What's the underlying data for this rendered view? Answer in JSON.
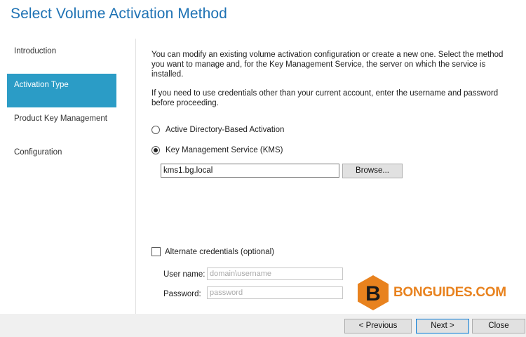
{
  "header": {
    "title": "Select Volume Activation Method"
  },
  "nav": {
    "items": [
      {
        "label": "Introduction"
      },
      {
        "label": "Activation Type"
      },
      {
        "label": "Product Key Management"
      },
      {
        "label": "Configuration"
      }
    ],
    "active_index": 1
  },
  "main": {
    "intro": "You can modify an existing volume activation configuration or create a new one. Select the method you want to manage and, for the Key Management Service, the server on which the service is installed.",
    "credentials_note": "If you need to use credentials other than your current account, enter the username and password before proceeding.",
    "options": [
      {
        "label": "Active Directory-Based Activation",
        "selected": false
      },
      {
        "label": "Key Management Service (KMS)",
        "selected": true
      }
    ],
    "server_value": "kms1.bg.local",
    "browse_label": "Browse...",
    "alt_credentials": {
      "label": "Alternate credentials (optional)",
      "checked": false
    },
    "username": {
      "label": "User name:",
      "placeholder": "domain\\username"
    },
    "password": {
      "label": "Password:",
      "placeholder": "password"
    }
  },
  "footer": {
    "previous_label": "< Previous",
    "next_label": "Next >",
    "close_label": "Close"
  },
  "watermark": {
    "letter": "B",
    "text": "BONGUIDES.COM",
    "color": "#e8821e"
  },
  "colors": {
    "title": "#1e72b4",
    "nav_active": "#2b9cc6",
    "default_button_border": "#0078d7"
  }
}
